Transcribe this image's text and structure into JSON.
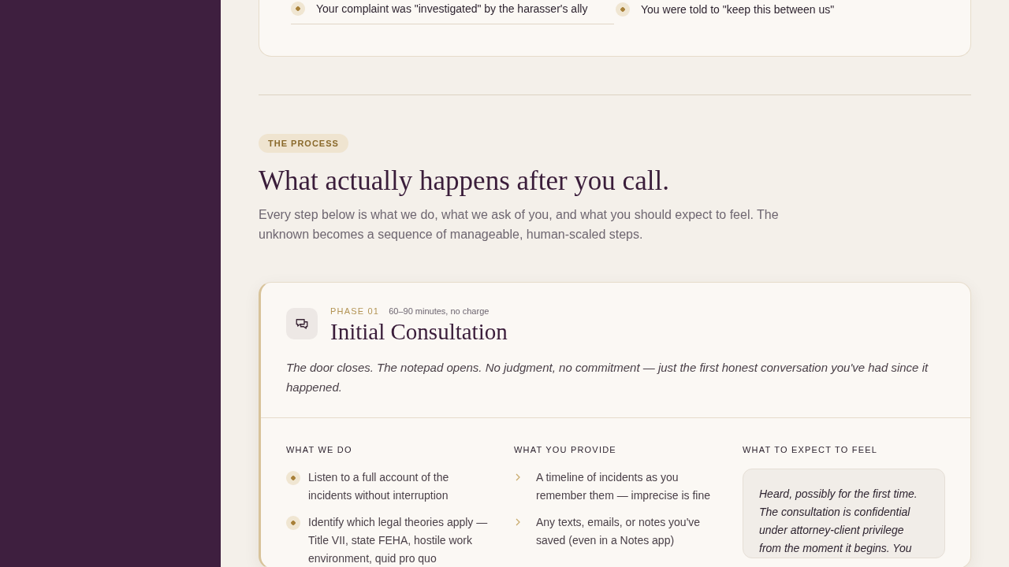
{
  "previous_card": {
    "items": [
      {
        "text": "Your complaint was \"investigated\" by the harasser's ally"
      },
      {
        "text": "You were told to \"keep this between us\""
      }
    ]
  },
  "process": {
    "eyebrow": "THE PROCESS",
    "heading": "What actually happens after you call.",
    "intro": "Every step below is what we do, what we ask of you, and what you should expect to feel. The unknown becomes a sequence of manageable, human-scaled steps."
  },
  "phase": {
    "label": "PHASE 01",
    "duration": "60–90 minutes, no charge",
    "title": "Initial Consultation",
    "summary": "The door closes. The notepad opens. No judgment, no commitment — just the first honest conversation you've had since it happened.",
    "columns": [
      {
        "kind": "dots",
        "heading": "WHAT WE DO",
        "items": [
          "Listen to a full account of the incidents without interruption",
          "Identify which legal theories apply — Title VII, state FEHA, hostile work environment, quid pro quo"
        ]
      },
      {
        "kind": "chevrons",
        "heading": "WHAT YOU PROVIDE",
        "items": [
          "A timeline of incidents as you remember them — imprecise is fine",
          "Any texts, emails, or notes you've saved (even in a Notes app)"
        ]
      },
      {
        "kind": "quote",
        "heading": "WHAT TO EXPECT TO FEEL",
        "text": "Heard, possibly for the first time. The consultation is confidential under attorney-client privilege from the moment it begins. You"
      }
    ]
  }
}
